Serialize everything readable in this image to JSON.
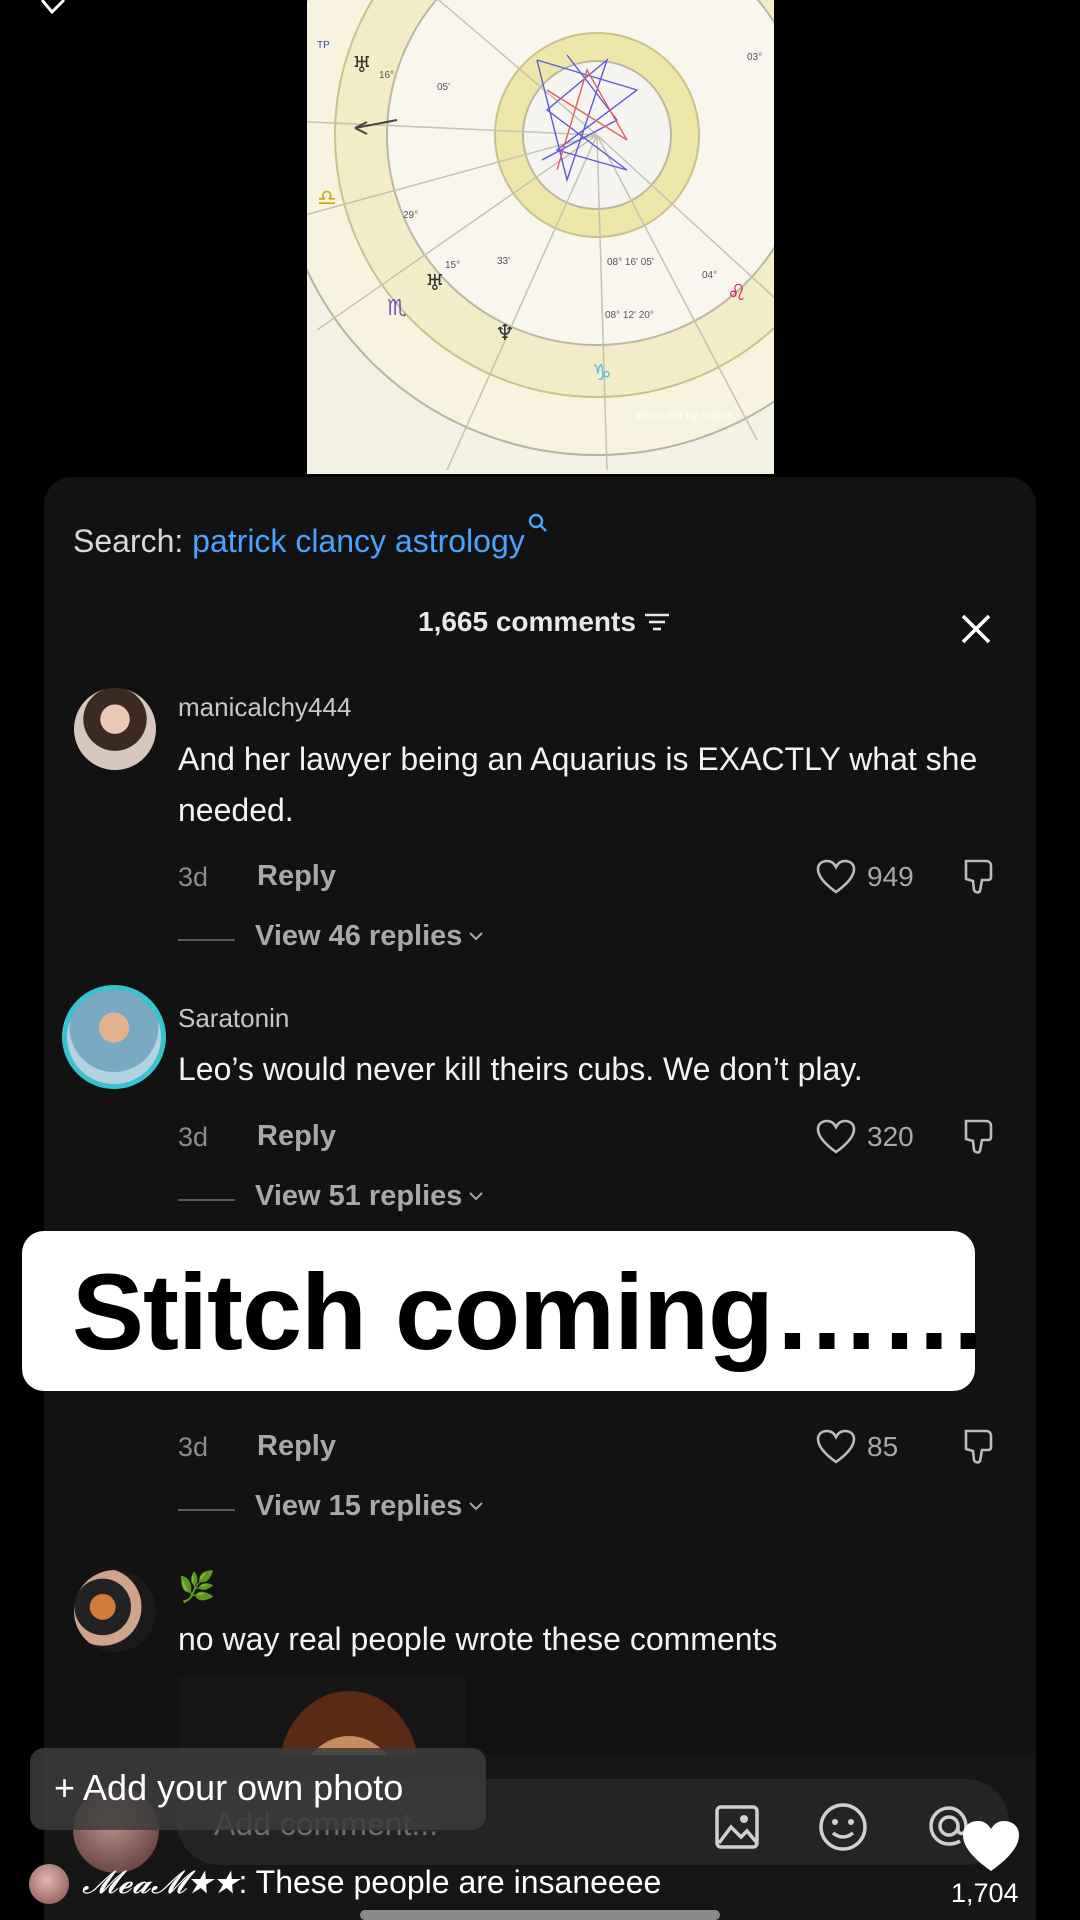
{
  "search": {
    "prefix": "Search:",
    "term": "patrick clancy astrology"
  },
  "comments_header": {
    "count_label": "1,665 comments"
  },
  "chart_image": {
    "caption": "also ruled by Saturn."
  },
  "comments": [
    {
      "username": "manicalchy444",
      "text": "And her lawyer being an Aquarius is EXACTLY what she needed.",
      "time": "3d",
      "reply_label": "Reply",
      "likes": "949",
      "view_replies": "View 46 replies"
    },
    {
      "username": "Saratonin",
      "text": "Leo’s would never kill theirs cubs. We don’t play.",
      "time": "3d",
      "reply_label": "Reply",
      "likes": "320",
      "view_replies": "View 51 replies"
    },
    {
      "username": "",
      "text": "",
      "time": "3d",
      "reply_label": "Reply",
      "likes": "85",
      "view_replies": "View 15 replies"
    },
    {
      "username": "🌿",
      "text": "no way real people wrote these comments"
    }
  ],
  "overlay": {
    "caption": "Stitch coming……"
  },
  "input": {
    "placeholder": "Add comment...",
    "add_photo_label": "+ Add your own photo"
  },
  "video": {
    "like_count": "1,704"
  },
  "ticker": {
    "name": "𝓜𝓮𝓪𝓜★★",
    "message": ": These people are insaneeee"
  },
  "colors": {
    "accent_link": "#4aa3ff",
    "sheet_bg": "#121212",
    "chart_bg": "#f3f0e4"
  }
}
